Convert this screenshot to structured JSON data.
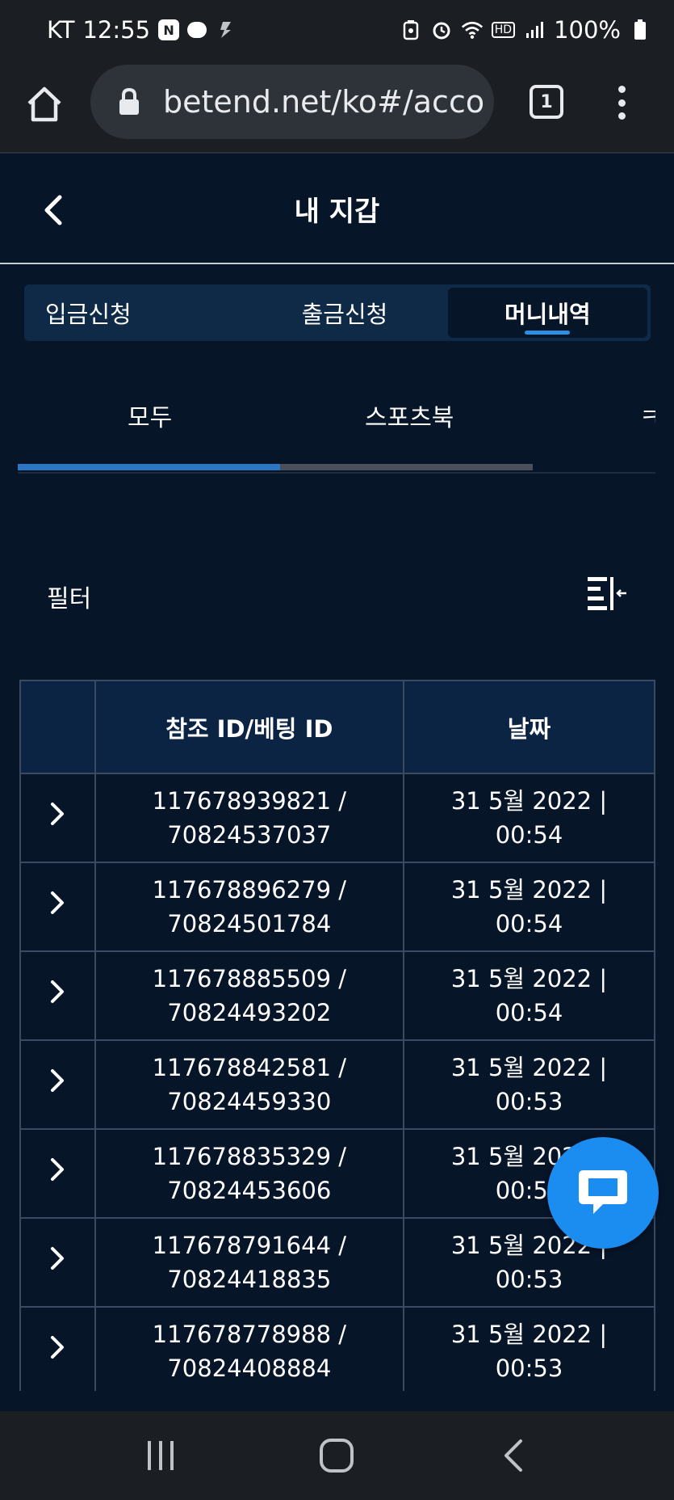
{
  "status_bar": {
    "carrier": "KT",
    "time": "12:55",
    "battery": "100%",
    "hd_label": "HD"
  },
  "browser": {
    "url": "betend.net/ko#/account",
    "tab_count": "1"
  },
  "header": {
    "title": "내 지갑"
  },
  "top_tabs": [
    {
      "label": "입금신청",
      "active": false
    },
    {
      "label": "출금신청",
      "active": false
    },
    {
      "label": "머니내역",
      "active": true
    }
  ],
  "sub_tabs": [
    {
      "label": "모두",
      "active": true
    },
    {
      "label": "스포츠북",
      "active": false
    },
    {
      "label": "ㅋ",
      "active": false
    }
  ],
  "sub_tabs_progress": 0.51,
  "filter": {
    "label": "필터"
  },
  "table": {
    "columns": [
      "",
      "참조 ID/베팅 ID",
      "날짜"
    ],
    "rows": [
      {
        "ref": "117678939821 /",
        "bet": "70824537037",
        "date": "31 5월 2022 |",
        "time": "00:54"
      },
      {
        "ref": "117678896279 /",
        "bet": "70824501784",
        "date": "31 5월 2022 |",
        "time": "00:54"
      },
      {
        "ref": "117678885509 /",
        "bet": "70824493202",
        "date": "31 5월 2022 |",
        "time": "00:54"
      },
      {
        "ref": "117678842581 /",
        "bet": "70824459330",
        "date": "31 5월 2022 |",
        "time": "00:53"
      },
      {
        "ref": "117678835329 /",
        "bet": "70824453606",
        "date": "31 5월 2022 |",
        "time": "00:53"
      },
      {
        "ref": "117678791644 /",
        "bet": "70824418835",
        "date": "31 5월 2022 |",
        "time": "00:53"
      },
      {
        "ref": "117678778988 /",
        "bet": "70824408884",
        "date": "31 5월 2022 |",
        "time": "00:53"
      }
    ]
  },
  "colors": {
    "background": "#071529",
    "accent": "#2f8de4",
    "chat_fab": "#1b8cf0",
    "table_header": "#0c2444"
  },
  "icons": {
    "home": "home-icon",
    "lock": "lock-icon",
    "back": "chevron-left-icon",
    "filter": "filter-collapse-icon",
    "expand": "chevron-right-icon",
    "chat": "chat-bubble-icon"
  }
}
